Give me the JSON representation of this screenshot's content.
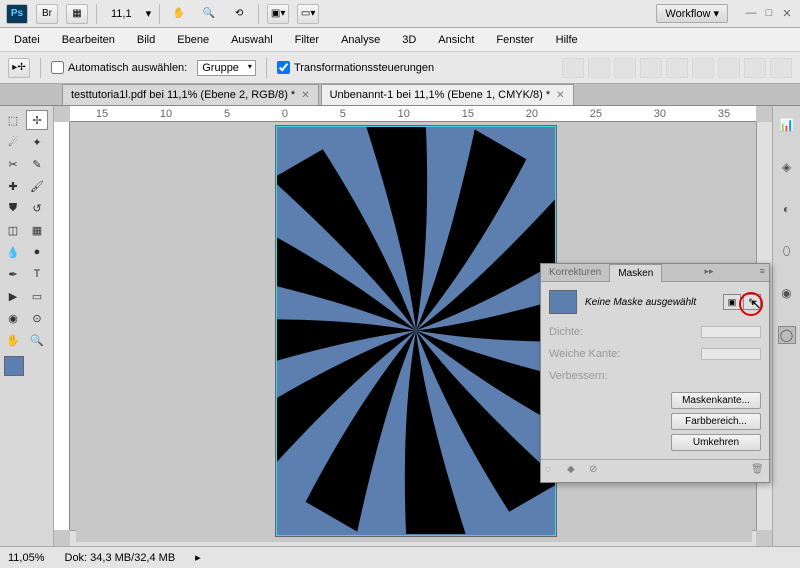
{
  "toolbar": {
    "zoom": "11,1",
    "workflow": "Workflow ▾"
  },
  "menu": [
    "Datei",
    "Bearbeiten",
    "Bild",
    "Ebene",
    "Auswahl",
    "Filter",
    "Analyse",
    "3D",
    "Ansicht",
    "Fenster",
    "Hilfe"
  ],
  "options": {
    "auto_select": "Automatisch auswählen:",
    "group": "Gruppe",
    "transform": "Transformationssteuerungen"
  },
  "tabs": [
    {
      "label": "testtutoria1l.pdf bei 11,1% (Ebene 2, RGB/8) *",
      "active": false
    },
    {
      "label": "Unbenannt-1 bei 11,1% (Ebene 1, CMYK/8) *",
      "active": true
    }
  ],
  "ruler_marks": [
    "15",
    "10",
    "5",
    "0",
    "5",
    "10",
    "15",
    "20",
    "25",
    "30",
    "35"
  ],
  "masks": {
    "tab_korrekturen": "Korrekturen",
    "tab_masken": "Masken",
    "none_selected": "Keine Maske ausgewählt",
    "dichte": "Dichte:",
    "weiche": "Weiche Kante:",
    "verbessern": "Verbessern:",
    "btn_kante": "Maskenkante...",
    "btn_farb": "Farbbereich...",
    "btn_umkehren": "Umkehren"
  },
  "status": {
    "zoom": "11,05%",
    "dok": "Dok: 34,3 MB/32,4 MB"
  }
}
